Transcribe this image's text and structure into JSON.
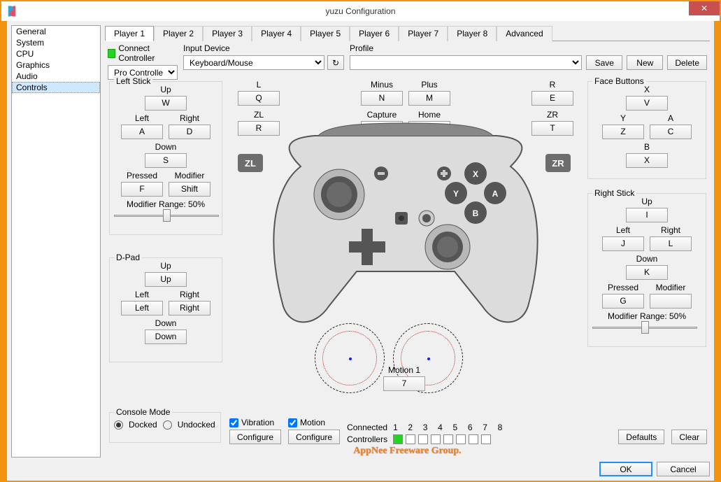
{
  "window": {
    "title": "yuzu Configuration",
    "close_tooltip": "Close"
  },
  "sidebar": {
    "items": [
      "General",
      "System",
      "CPU",
      "Graphics",
      "Audio",
      "Controls"
    ],
    "selected": "Controls"
  },
  "tabs": [
    "Player 1",
    "Player 2",
    "Player 3",
    "Player 4",
    "Player 5",
    "Player 6",
    "Player 7",
    "Player 8",
    "Advanced"
  ],
  "active_tab": "Player 1",
  "connect": {
    "label": "Connect Controller",
    "controller_type": "Pro Controller"
  },
  "input_device": {
    "label": "Input Device",
    "value": "Keyboard/Mouse"
  },
  "profile": {
    "label": "Profile",
    "save": "Save",
    "new": "New",
    "delete": "Delete"
  },
  "left_stick": {
    "label": "Left Stick",
    "up": {
      "lbl": "Up",
      "val": "W"
    },
    "left": {
      "lbl": "Left",
      "val": "A"
    },
    "right": {
      "lbl": "Right",
      "val": "D"
    },
    "down": {
      "lbl": "Down",
      "val": "S"
    },
    "pressed": {
      "lbl": "Pressed",
      "val": "F"
    },
    "modifier": {
      "lbl": "Modifier",
      "val": "Shift"
    },
    "range_label": "Modifier Range: 50%",
    "range_pct": 50
  },
  "shoulders_left": {
    "l": {
      "lbl": "L",
      "val": "Q"
    },
    "zl": {
      "lbl": "ZL",
      "val": "R"
    }
  },
  "center_top": {
    "minus": {
      "lbl": "Minus",
      "val": "N"
    },
    "plus": {
      "lbl": "Plus",
      "val": "M"
    },
    "capture": {
      "lbl": "Capture",
      "val": ""
    },
    "home": {
      "lbl": "Home",
      "val": ""
    }
  },
  "shoulders_right": {
    "r": {
      "lbl": "R",
      "val": "E"
    },
    "zr": {
      "lbl": "ZR",
      "val": "T"
    }
  },
  "face": {
    "label": "Face Buttons",
    "x": {
      "lbl": "X",
      "val": "V"
    },
    "y": {
      "lbl": "Y",
      "val": "Z"
    },
    "a": {
      "lbl": "A",
      "val": "C"
    },
    "b": {
      "lbl": "B",
      "val": "X"
    }
  },
  "right_stick": {
    "label": "Right Stick",
    "up": {
      "lbl": "Up",
      "val": "I"
    },
    "left": {
      "lbl": "Left",
      "val": "J"
    },
    "right": {
      "lbl": "Right",
      "val": "L"
    },
    "down": {
      "lbl": "Down",
      "val": "K"
    },
    "pressed": {
      "lbl": "Pressed",
      "val": "G"
    },
    "modifier": {
      "lbl": "Modifier",
      "val": ""
    },
    "range_label": "Modifier Range: 50%",
    "range_pct": 50
  },
  "dpad": {
    "label": "D-Pad",
    "up": {
      "lbl": "Up",
      "val": "Up"
    },
    "left": {
      "lbl": "Left",
      "val": "Left"
    },
    "right": {
      "lbl": "Right",
      "val": "Right"
    },
    "down": {
      "lbl": "Down",
      "val": "Down"
    }
  },
  "badges": {
    "zl": "ZL",
    "zr": "ZR"
  },
  "motion": {
    "label": "Motion 1",
    "val": "7"
  },
  "console_mode": {
    "label": "Console Mode",
    "docked": "Docked",
    "undocked": "Undocked",
    "sel": "docked"
  },
  "vibration": {
    "label": "Vibration",
    "checked": true,
    "configure": "Configure"
  },
  "motion_toggle": {
    "label": "Motion",
    "checked": true,
    "configure": "Configure"
  },
  "connected": {
    "label": "Connected",
    "controllers": "Controllers",
    "numbers": [
      "1",
      "2",
      "3",
      "4",
      "5",
      "6",
      "7",
      "8"
    ],
    "active": [
      true,
      false,
      false,
      false,
      false,
      false,
      false,
      false
    ]
  },
  "defaults": "Defaults",
  "clear": "Clear",
  "ok": "OK",
  "cancel": "Cancel",
  "watermark": "AppNee Freeware Group."
}
